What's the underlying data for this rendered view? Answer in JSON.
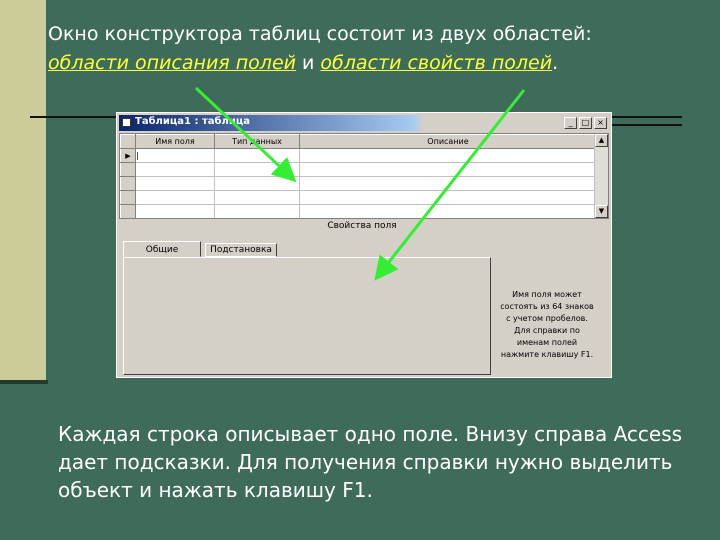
{
  "heading": {
    "line1": "Окно конструктора таблиц состоит из двух областей:",
    "highlight1": "области описания полей",
    "connector": " и ",
    "highlight2": "области свойств полей",
    "period": "."
  },
  "window": {
    "title": "Таблица1 : таблица",
    "controls": {
      "minimize": "_",
      "maximize": "□",
      "close": "×"
    },
    "columns": [
      "Имя поля",
      "Тип данных",
      "Описание"
    ],
    "row_count": 6,
    "properties_label": "Свойства поля",
    "tabs": [
      "Общие",
      "Подстановка"
    ],
    "hint": "Имя поля может состоять из 64 знаков с учетом пробелов. Для справки по именам полей нажмите клавишу F1."
  },
  "footer": "Каждая строка описывает одно поле. Внизу справа Access дает подсказки. Для получения справки нужно выделить объект и нажать клавишу F1.",
  "colors": {
    "background": "#3f6b5a",
    "left_bar": "#cccc99",
    "highlight": "#ffff33",
    "arrow": "#33ee33"
  }
}
